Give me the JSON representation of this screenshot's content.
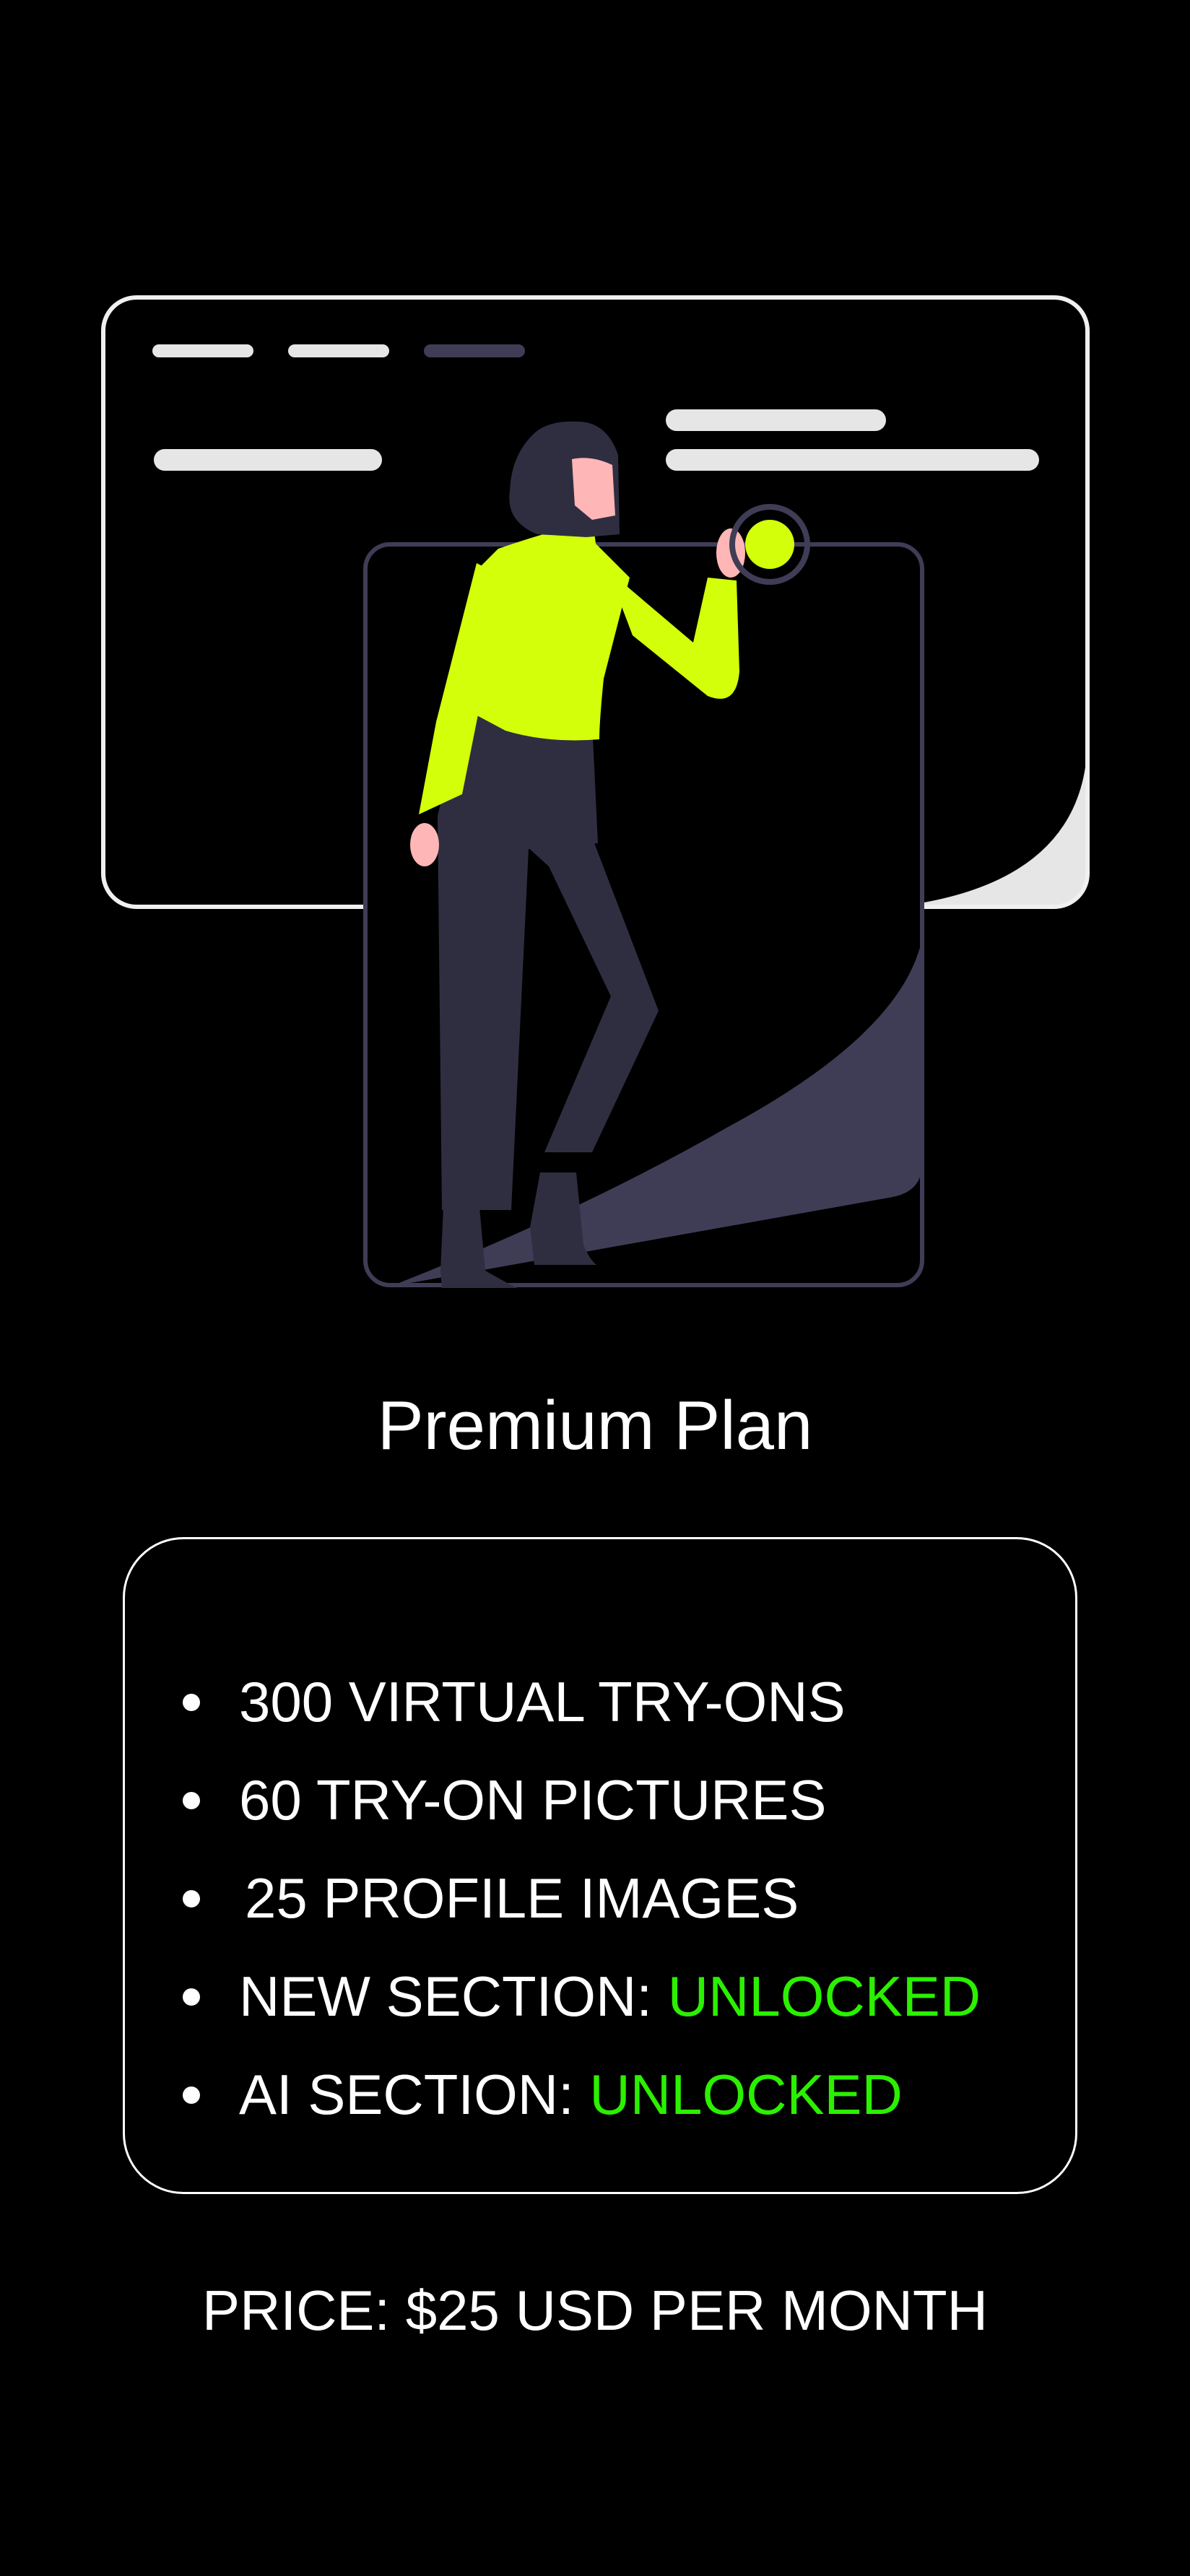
{
  "plan": {
    "title": "Premium Plan"
  },
  "features": [
    {
      "text": "300 VIRTUAL TRY-ONS"
    },
    {
      "text": "60 TRY-ON PICTURES"
    },
    {
      "text": "25 PROFILE IMAGES"
    },
    {
      "label": "NEW SECTION: ",
      "status": "UNLOCKED"
    },
    {
      "label": "AI SECTION: ",
      "status": "UNLOCKED"
    }
  ],
  "price": {
    "text": "PRICE: $25 USD PER MONTH"
  },
  "colors": {
    "background": "#000000",
    "text": "#ffffff",
    "unlocked": "#2bf000",
    "accent_lime": "#d4ff0a",
    "illustration_purple": "#3f3d56"
  },
  "illustration": {
    "icon": "woman-pressing-button-illustration"
  }
}
